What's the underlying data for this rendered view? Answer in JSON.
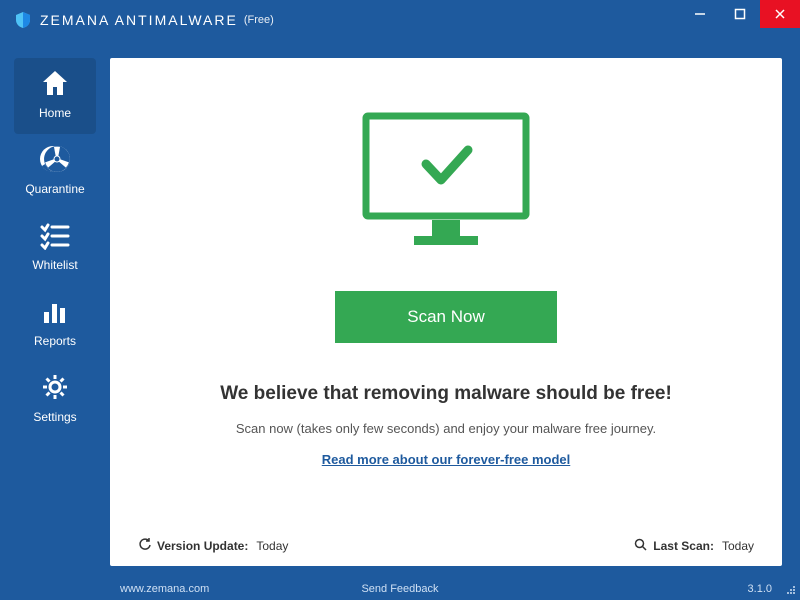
{
  "titlebar": {
    "app_name": "ZEMANA ANTIMALWARE",
    "edition": "(Free)"
  },
  "sidebar": {
    "items": [
      {
        "label": "Home",
        "icon": "home-icon"
      },
      {
        "label": "Quarantine",
        "icon": "quarantine-icon"
      },
      {
        "label": "Whitelist",
        "icon": "whitelist-icon"
      },
      {
        "label": "Reports",
        "icon": "reports-icon"
      },
      {
        "label": "Settings",
        "icon": "settings-icon"
      }
    ]
  },
  "main": {
    "scan_button_label": "Scan Now",
    "headline": "We believe that removing malware should be free!",
    "tagline": "Scan now (takes only few seconds) and enjoy your malware free journey.",
    "readmore_label": "Read more about our forever-free model",
    "version_update_label": "Version Update:",
    "version_update_value": "Today",
    "last_scan_label": "Last Scan:",
    "last_scan_value": "Today"
  },
  "footer": {
    "url": "www.zemana.com",
    "feedback_label": "Send Feedback",
    "version": "3.1.0"
  },
  "colors": {
    "brand_blue": "#1e5a9e",
    "accent_green": "#34a853",
    "close_red": "#e81123"
  }
}
